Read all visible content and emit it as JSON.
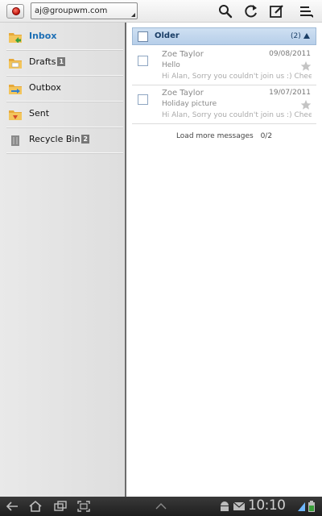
{
  "topbar": {
    "app_icon": "email-app-icon",
    "account": "aj@groupwm.com",
    "actions": [
      {
        "name": "search-icon"
      },
      {
        "name": "refresh-icon"
      },
      {
        "name": "compose-icon"
      },
      {
        "name": "menu-icon"
      }
    ]
  },
  "sidebar": {
    "folders": [
      {
        "label": "Inbox",
        "count": "",
        "icon": "inbox-folder-icon",
        "active": true
      },
      {
        "label": "Drafts",
        "count": "1",
        "icon": "drafts-folder-icon",
        "active": false
      },
      {
        "label": "Outbox",
        "count": "",
        "icon": "outbox-folder-icon",
        "active": false
      },
      {
        "label": "Sent",
        "count": "",
        "icon": "sent-folder-icon",
        "active": false
      },
      {
        "label": "Recycle Bin",
        "count": "2",
        "icon": "recycle-bin-icon",
        "active": false
      }
    ]
  },
  "list": {
    "group": {
      "title": "Older",
      "count": "(2)"
    },
    "messages": [
      {
        "sender": "Zoe Taylor",
        "date": "09/08/2011",
        "subject": "Hello",
        "preview": "Hi Alan, Sorry you couldn't join us :) Cheer..."
      },
      {
        "sender": "Zoe Taylor",
        "date": "19/07/2011",
        "subject": "Holiday picture",
        "preview": "Hi Alan, Sorry you couldn't join us :) Cheer..."
      }
    ],
    "load_more": {
      "label": "Load more messages",
      "count": "0/2"
    }
  },
  "sysbar": {
    "time": "10:10",
    "accent": "#1d6fb5"
  }
}
